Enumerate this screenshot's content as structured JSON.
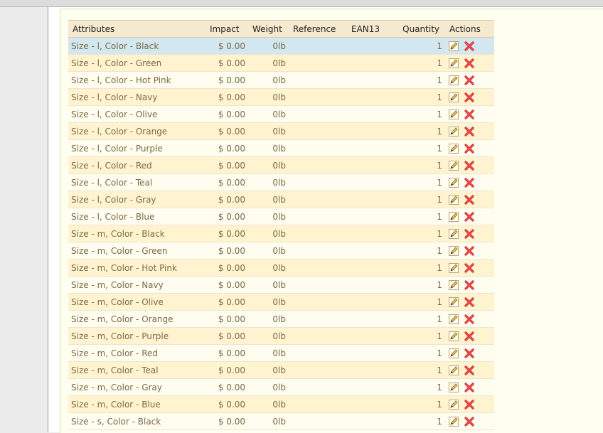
{
  "table": {
    "columns": {
      "attributes": "Attributes",
      "impact": "Impact",
      "weight": "Weight",
      "reference": "Reference",
      "ean13": "EAN13",
      "quantity": "Quantity",
      "actions": "Actions"
    },
    "rows": [
      {
        "attributes": "Size - l, Color - Black",
        "impact": "$ 0.00",
        "weight": "0lb",
        "reference": "",
        "ean13": "",
        "quantity": "1"
      },
      {
        "attributes": "Size - l, Color - Green",
        "impact": "$ 0.00",
        "weight": "0lb",
        "reference": "",
        "ean13": "",
        "quantity": "1"
      },
      {
        "attributes": "Size - l, Color - Hot Pink",
        "impact": "$ 0.00",
        "weight": "0lb",
        "reference": "",
        "ean13": "",
        "quantity": "1"
      },
      {
        "attributes": "Size - l, Color - Navy",
        "impact": "$ 0.00",
        "weight": "0lb",
        "reference": "",
        "ean13": "",
        "quantity": "1"
      },
      {
        "attributes": "Size - l, Color - Olive",
        "impact": "$ 0.00",
        "weight": "0lb",
        "reference": "",
        "ean13": "",
        "quantity": "1"
      },
      {
        "attributes": "Size - l, Color - Orange",
        "impact": "$ 0.00",
        "weight": "0lb",
        "reference": "",
        "ean13": "",
        "quantity": "1"
      },
      {
        "attributes": "Size - l, Color - Purple",
        "impact": "$ 0.00",
        "weight": "0lb",
        "reference": "",
        "ean13": "",
        "quantity": "1"
      },
      {
        "attributes": "Size - l, Color - Red",
        "impact": "$ 0.00",
        "weight": "0lb",
        "reference": "",
        "ean13": "",
        "quantity": "1"
      },
      {
        "attributes": "Size - l, Color - Teal",
        "impact": "$ 0.00",
        "weight": "0lb",
        "reference": "",
        "ean13": "",
        "quantity": "1"
      },
      {
        "attributes": "Size - l, Color - Gray",
        "impact": "$ 0.00",
        "weight": "0lb",
        "reference": "",
        "ean13": "",
        "quantity": "1"
      },
      {
        "attributes": "Size - l, Color - Blue",
        "impact": "$ 0.00",
        "weight": "0lb",
        "reference": "",
        "ean13": "",
        "quantity": "1"
      },
      {
        "attributes": "Size - m, Color - Black",
        "impact": "$ 0.00",
        "weight": "0lb",
        "reference": "",
        "ean13": "",
        "quantity": "1"
      },
      {
        "attributes": "Size - m, Color - Green",
        "impact": "$ 0.00",
        "weight": "0lb",
        "reference": "",
        "ean13": "",
        "quantity": "1"
      },
      {
        "attributes": "Size - m, Color - Hot Pink",
        "impact": "$ 0.00",
        "weight": "0lb",
        "reference": "",
        "ean13": "",
        "quantity": "1"
      },
      {
        "attributes": "Size - m, Color - Navy",
        "impact": "$ 0.00",
        "weight": "0lb",
        "reference": "",
        "ean13": "",
        "quantity": "1"
      },
      {
        "attributes": "Size - m, Color - Olive",
        "impact": "$ 0.00",
        "weight": "0lb",
        "reference": "",
        "ean13": "",
        "quantity": "1"
      },
      {
        "attributes": "Size - m, Color - Orange",
        "impact": "$ 0.00",
        "weight": "0lb",
        "reference": "",
        "ean13": "",
        "quantity": "1"
      },
      {
        "attributes": "Size - m, Color - Purple",
        "impact": "$ 0.00",
        "weight": "0lb",
        "reference": "",
        "ean13": "",
        "quantity": "1"
      },
      {
        "attributes": "Size - m, Color - Red",
        "impact": "$ 0.00",
        "weight": "0lb",
        "reference": "",
        "ean13": "",
        "quantity": "1"
      },
      {
        "attributes": "Size - m, Color - Teal",
        "impact": "$ 0.00",
        "weight": "0lb",
        "reference": "",
        "ean13": "",
        "quantity": "1"
      },
      {
        "attributes": "Size - m, Color - Gray",
        "impact": "$ 0.00",
        "weight": "0lb",
        "reference": "",
        "ean13": "",
        "quantity": "1"
      },
      {
        "attributes": "Size - m, Color - Blue",
        "impact": "$ 0.00",
        "weight": "0lb",
        "reference": "",
        "ean13": "",
        "quantity": "1"
      },
      {
        "attributes": "Size - s, Color - Black",
        "impact": "$ 0.00",
        "weight": "0lb",
        "reference": "",
        "ean13": "",
        "quantity": "1"
      }
    ]
  },
  "icons": {
    "edit": "pencil-icon",
    "delete": "delete-x-icon"
  },
  "colors": {
    "header_bg": "#f5e9cf",
    "row_even": "#fff4cf",
    "row_odd": "#fffdf0",
    "row_selected": "#d2e7ef",
    "text": "#7b6a45",
    "delete_red": "#d8282a",
    "edit_yellow": "#f0c24a"
  }
}
